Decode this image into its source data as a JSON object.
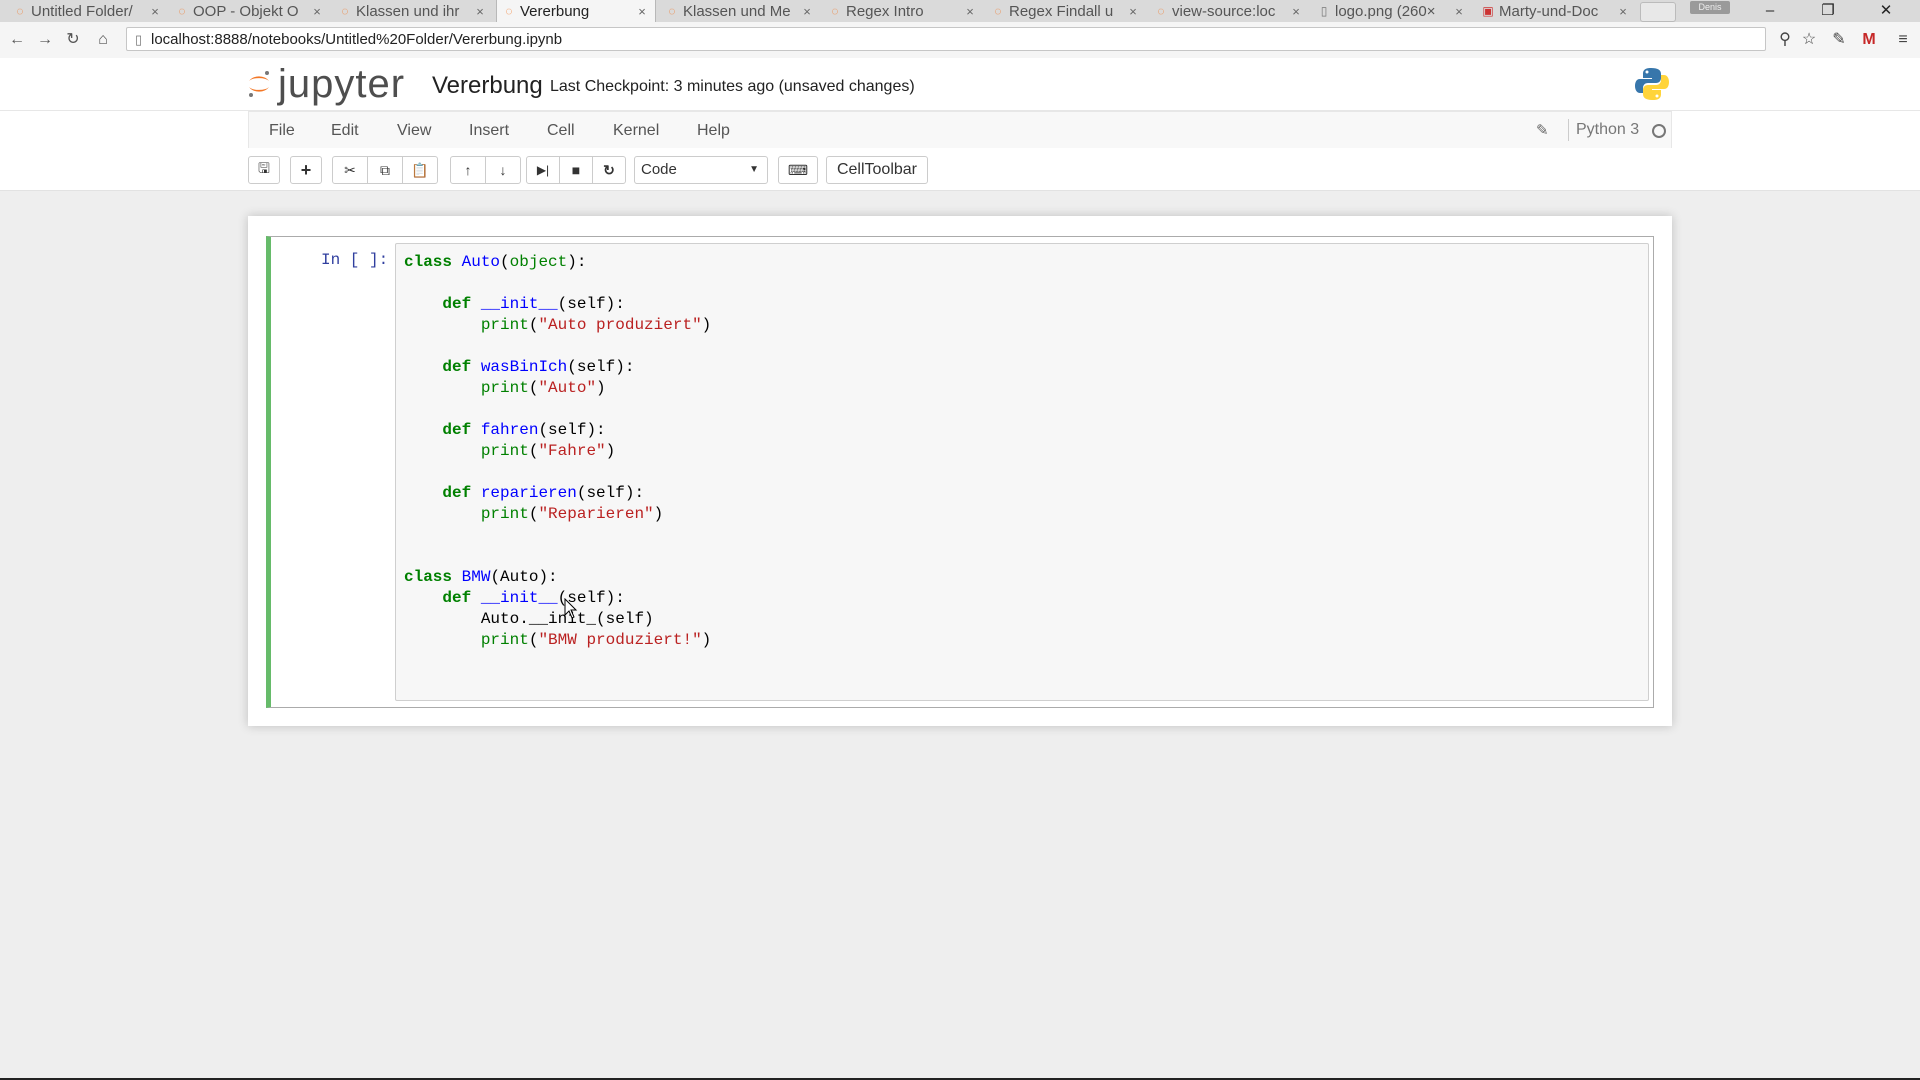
{
  "browser": {
    "tabs": [
      {
        "label": "Untitled Folder/",
        "icon": "jupyter-icon",
        "active": false
      },
      {
        "label": "OOP - Objekt O",
        "icon": "jupyter-icon",
        "active": false
      },
      {
        "label": "Klassen und ihr",
        "icon": "jupyter-icon",
        "active": false
      },
      {
        "label": "Vererbung",
        "icon": "jupyter-icon",
        "active": true
      },
      {
        "label": "Klassen und Me",
        "icon": "jupyter-icon",
        "active": false
      },
      {
        "label": "Regex Intro",
        "icon": "jupyter-icon",
        "active": false
      },
      {
        "label": "Regex Findall u",
        "icon": "jupyter-icon",
        "active": false
      },
      {
        "label": "view-source:loc",
        "icon": "jupyter-icon",
        "active": false
      },
      {
        "label": "logo.png (260×",
        "icon": "file-icon",
        "active": false
      },
      {
        "label": "Marty-und-Doc",
        "icon": "bookmark-icon",
        "active": false
      }
    ],
    "tab_close": "×",
    "profile_label": "Denis",
    "url": "localhost:8888/notebooks/Untitled%20Folder/Vererbung.ipynb"
  },
  "jupyter": {
    "logo_text": "jupyter",
    "notebook_name": "Vererbung",
    "checkpoint": "Last Checkpoint: 3 minutes ago (unsaved changes)",
    "menu": [
      "File",
      "Edit",
      "View",
      "Insert",
      "Cell",
      "Kernel",
      "Help"
    ],
    "kernel_name": "Python 3",
    "cell_type": "Code",
    "celltoolbar_label": "CellToolbar"
  },
  "cell": {
    "prompt": "In [ ]:"
  },
  "colors": {
    "selected_cell_border": "#66bb6a",
    "prompt": "#303f9f",
    "keyword": "#008000",
    "name": "#0000ff",
    "string": "#ba2121",
    "jupyter_orange": "#f37726"
  }
}
